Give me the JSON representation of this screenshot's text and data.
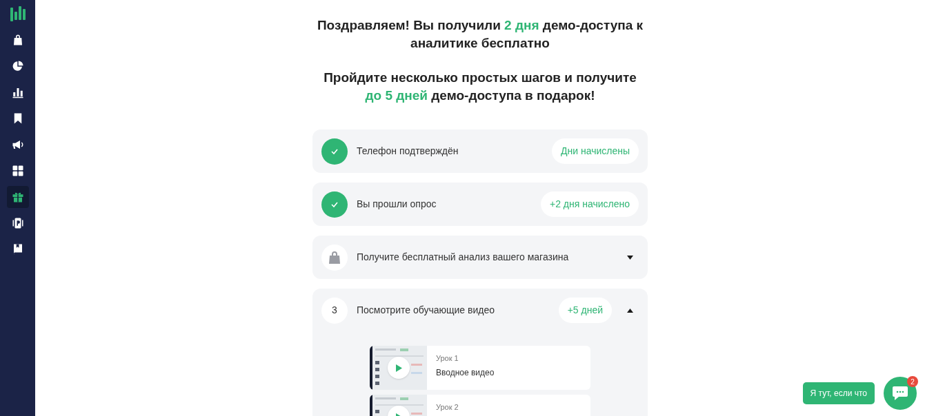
{
  "sidebar": {
    "items": [
      {
        "kind": "logo",
        "selected": false
      },
      {
        "kind": "bag",
        "selected": false
      },
      {
        "kind": "pie",
        "selected": false
      },
      {
        "kind": "bars",
        "selected": false
      },
      {
        "kind": "bookmark",
        "selected": false
      },
      {
        "kind": "megaphone",
        "selected": false
      },
      {
        "kind": "grid",
        "selected": false
      },
      {
        "kind": "gift",
        "selected": true
      },
      {
        "kind": "parking",
        "selected": false
      },
      {
        "kind": "book",
        "selected": false
      }
    ]
  },
  "headings": [
    [
      {
        "text": "Поздравляем! Вы получили ",
        "highlight": false
      },
      {
        "text": "2 дня",
        "highlight": true
      },
      {
        "text": " демо-доступа к аналитике бесплатно",
        "highlight": false
      }
    ],
    [
      {
        "text": "Пройдите несколько простых шагов и получите ",
        "highlight": false
      },
      {
        "text": "до 5 дней",
        "highlight": true
      },
      {
        "text": " демо-доступа в подарок!",
        "highlight": false
      }
    ]
  ],
  "steps": [
    {
      "kind": "done",
      "title": "Телефон подтверждён",
      "badge": "Дни начислены"
    },
    {
      "kind": "done",
      "title": "Вы прошли опрос",
      "badge": "+2 дня начислено"
    },
    {
      "kind": "locked",
      "title": "Получите бесплатный анализ вашего магазина",
      "expanded": false
    },
    {
      "kind": "number",
      "number": "3",
      "title": "Посмотрите обучающие видео",
      "badge": "+5 дней",
      "expanded": true,
      "videos": [
        {
          "lesson": "Урок 1",
          "title": "Вводное видео"
        },
        {
          "lesson": "Урок 2"
        }
      ]
    }
  ],
  "chat": {
    "label": "Я тут, если что",
    "unread": "2"
  }
}
